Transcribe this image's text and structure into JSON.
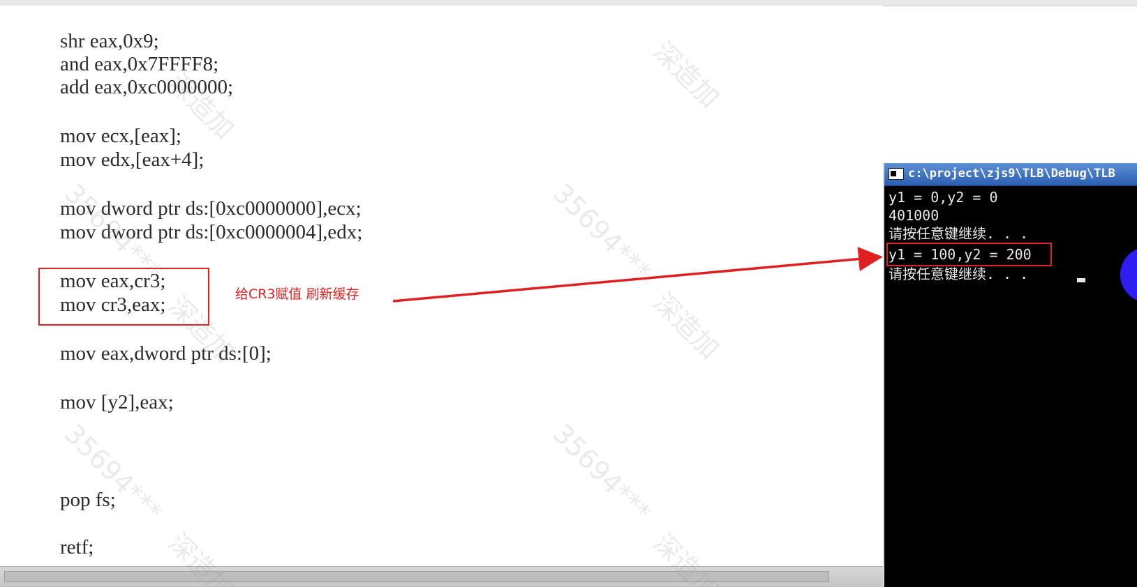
{
  "code": {
    "lines": [
      "shr eax,0x9;",
      "and eax,0x7FFFF8;",
      "add eax,0xc0000000;",
      "mov ecx,[eax];",
      "mov edx,[eax+4];",
      "mov dword ptr ds:[0xc0000000],ecx;",
      "mov dword ptr ds:[0xc0000004],edx;",
      "mov eax,cr3;",
      "mov cr3,eax;",
      "mov eax,dword ptr ds:[0];",
      "mov [y2],eax;",
      "pop fs;",
      "retf;"
    ]
  },
  "annotation": {
    "text": "给CR3赋值 刷新缓存",
    "color": "#e02020"
  },
  "console": {
    "title": "c:\\project\\zjs9\\TLB\\Debug\\TLB",
    "lines": [
      "y1 = 0,y2 = 0",
      "401000",
      "请按任意键继续. . .",
      "y1 = 100,y2 = 200",
      "请按任意键继续. . ."
    ]
  },
  "watermarks": {
    "number": "35694***",
    "brand": "深造加"
  },
  "colors": {
    "annotation_red": "#e02020",
    "console_bg": "#000000",
    "blue_dot": "#2f1ef0"
  }
}
